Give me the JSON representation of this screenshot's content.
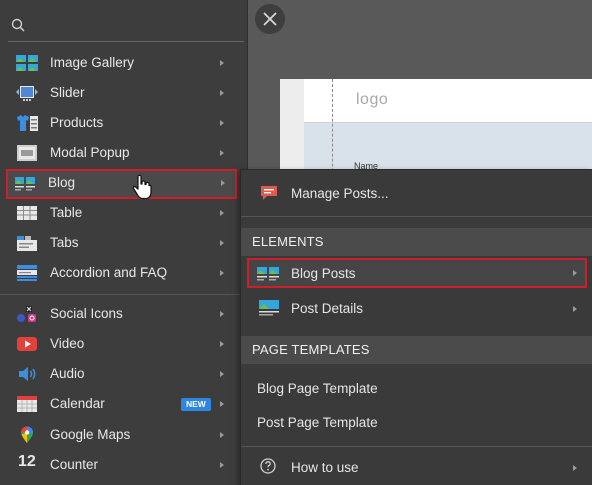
{
  "preview": {
    "logo_text": "logo",
    "name_label": "Name"
  },
  "search": {
    "placeholder": ""
  },
  "menu": {
    "items": [
      {
        "label": "Image Gallery",
        "icon": "image-gallery-icon"
      },
      {
        "label": "Slider",
        "icon": "slider-icon"
      },
      {
        "label": "Products",
        "icon": "products-icon"
      },
      {
        "label": "Modal Popup",
        "icon": "modal-popup-icon"
      },
      {
        "label": "Blog",
        "icon": "blog-icon",
        "selected": true
      },
      {
        "label": "Table",
        "icon": "table-icon"
      },
      {
        "label": "Tabs",
        "icon": "tabs-icon"
      },
      {
        "label": "Accordion and FAQ",
        "icon": "accordion-icon"
      },
      {
        "label": "Social Icons",
        "icon": "social-icons-icon"
      },
      {
        "label": "Video",
        "icon": "video-icon"
      },
      {
        "label": "Audio",
        "icon": "audio-icon"
      },
      {
        "label": "Calendar",
        "icon": "calendar-icon",
        "badge": "NEW"
      },
      {
        "label": "Google Maps",
        "icon": "google-maps-icon"
      },
      {
        "label": "Counter",
        "icon": "counter-icon",
        "icon_text": "12"
      }
    ]
  },
  "submenu": {
    "manage_label": "Manage Posts...",
    "elements_header": "ELEMENTS",
    "blog_posts_label": "Blog Posts",
    "post_details_label": "Post Details",
    "templates_header": "PAGE TEMPLATES",
    "blog_page_template": "Blog Page Template",
    "post_page_template": "Post Page Template",
    "how_to_use": "How to use"
  },
  "colors": {
    "highlight_border": "#cc1f2b",
    "menu_bg": "#3d3d3d",
    "badge_bg": "#2f86e0"
  }
}
